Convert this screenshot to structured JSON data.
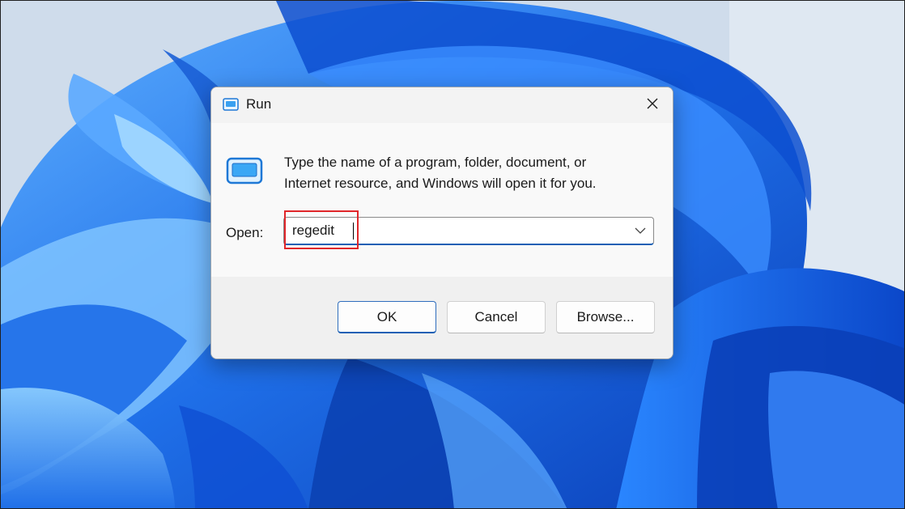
{
  "dialog": {
    "title": "Run",
    "description_line1": "Type the name of a program, folder, document, or",
    "description_line2": "Internet resource, and Windows will open it for you.",
    "open_label": "Open:",
    "open_value": "regedit",
    "ok_label": "OK",
    "cancel_label": "Cancel",
    "browse_label": "Browse..."
  },
  "icons": {
    "title": "run-app-icon",
    "body": "run-app-icon",
    "close": "close-icon",
    "dropdown": "chevron-down-icon"
  },
  "colors": {
    "accent": "#1a5fb4",
    "highlight": "#e0262a",
    "wallpaper_base": "#cfdceb",
    "bloom_blue": "#1f6fe8"
  }
}
